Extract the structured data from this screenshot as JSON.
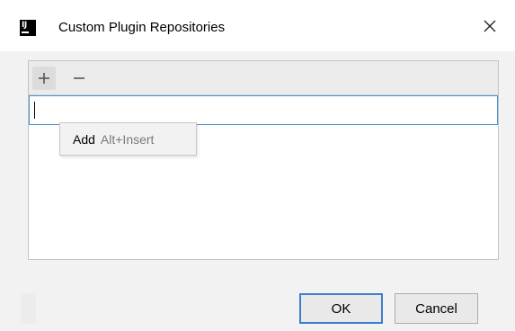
{
  "window": {
    "title": "Custom Plugin Repositories",
    "app_icon_text": "IJ"
  },
  "toolbar": {
    "add_icon": "plus-icon",
    "remove_icon": "minus-icon"
  },
  "repository_input": {
    "value": ""
  },
  "tooltip": {
    "label": "Add",
    "shortcut": "Alt+Insert"
  },
  "buttons": {
    "ok_label": "OK",
    "cancel_label": "Cancel"
  },
  "colors": {
    "accent": "#3c7fd0",
    "field_border": "#4a8fd6"
  }
}
